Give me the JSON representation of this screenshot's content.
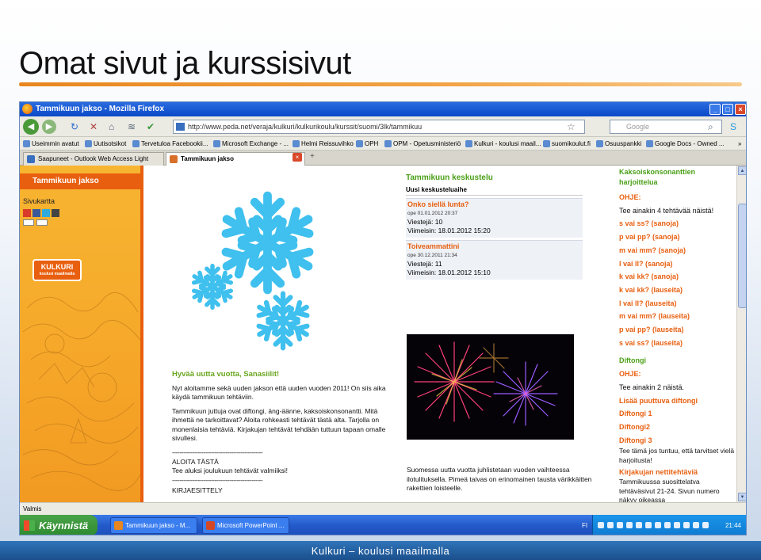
{
  "slide": {
    "title": "Omat sivut ja kurssisivut",
    "footer": "Kulkuri – koulusi maailmalla"
  },
  "browser": {
    "window_title": "Tammikuun jakso - Mozilla Firefox",
    "url": "http://www.peda.net/veraja/kulkuri/kulkurikoulu/kurssit/suomi/3lk/tammikuu",
    "search_placeholder": "Google",
    "bookmarks": [
      "Useimmin avatut",
      "Uutisotsikot",
      "Tervetuloa Facebookii...",
      "Microsoft Exchange - ...",
      "Helmi Reissuvihko",
      "OPH",
      "OPM - Opetusministeriö",
      "Kulkuri - koulusi maail...",
      "suomikoulut.fi",
      "Osuuspankki",
      "Google Docs - Owned ..."
    ],
    "tabs": [
      {
        "label": "Saapuneet - Outlook Web Access Light",
        "active": false
      },
      {
        "label": "Tammikuun jakso",
        "active": true
      }
    ],
    "status": "Valmis"
  },
  "page": {
    "nav_title": "Tammikuun jakso",
    "sitemap_label": "Sivukartta",
    "logo_text": "KULKURI",
    "logo_sub": "koulusi maailmalla",
    "post": {
      "heading": "Hyvää uutta vuotta, Sanasiilit!",
      "p1": "Nyt aloitamme sekä uuden jakson että uuden vuoden 2011! On siis aika käydä tammikuun tehtäviin.",
      "p2": "Tammikuun juttuja ovat diftongi, äng-äänne, kaksoiskonsonantti. Mitä ihmettä ne tarkoittavat? Aloita rohkeasti tehtävät tästä alta. Tarjolla on monenlaisia tehtäviä. Kirjakujan tehtävät tehdään tuttuun tapaan omalle sivullesi.",
      "dash1": "-------------------------------------------------",
      "start": "ALOITA TÄSTÄ",
      "start_text": "Tee aluksi joulukuun tehtävät valmiiksi!",
      "dash2": "-------------------------------------------------",
      "intro": "KIRJAESITTELY"
    },
    "forum": {
      "heading": "Tammikuun keskustelu",
      "subheading": "Uusi keskusteluaihe",
      "threads": [
        {
          "title": "Onko siellä lunta?",
          "meta": "ope 01.01.2012 20:37",
          "count": "Viestejä: 10",
          "latest": "Viimeisin: 18.01.2012 15:20"
        },
        {
          "title": "Toiveammattini",
          "meta": "ope 30.12.2011 21:34",
          "count": "Viestejä: 11",
          "latest": "Viimeisin: 18.01.2012 15:10"
        }
      ]
    },
    "fireworks_caption": "Suomessa uutta vuotta juhlistetaan vuoden vaihteessa ilotulituksella. Pimeä taivas on erinomainen tausta värikkäitten rakettien loisteelle.",
    "right": {
      "heading": "Kaksoiskonsonanttien harjoittelua",
      "ohje_label": "OHJE:",
      "ohje_text": "Tee ainakin 4 tehtävää näistä!",
      "links": [
        "s vai ss? (sanoja)",
        "p vai pp? (sanoja)",
        "m vai mm? (sanoja)",
        "l vai ll? (sanoja)",
        "k vai kk? (sanoja)",
        "k vai kk? (lauseita)",
        "l vai ll? (lauseita)",
        "m vai mm? (lauseita)",
        "p vai pp? (lauseita)",
        "s vai ss? (lauseita)"
      ],
      "diftongi_heading": "Diftongi",
      "diftongi_ohje_label": "OHJE:",
      "diftongi_ohje_text": "Tee ainakin 2 näistä.",
      "diftongi_links": [
        "Lisää puuttuva diftongi",
        "Diftongi 1",
        "Diftongi2",
        "Diftongi 3"
      ],
      "note": "Tee tämä jos tuntuu, että tarvitset vielä harjoitusta!",
      "kirjakuja_heading": "Kirjakujan nettitehtäviä",
      "kirjakuja_text": "Tammikuussa suosittelatva tehtäväsivut 21-24. Sivun numero näkyy oikeassa"
    }
  },
  "taskbar": {
    "start_label": "Käynnistä",
    "items": [
      "Tammikuun jakso - M...",
      "Microsoft PowerPoint ..."
    ],
    "lang": "FI",
    "clock": "21:44"
  },
  "colors": {
    "orange": "#e85f0f",
    "green": "#4ba018",
    "sidebar": "#f6a92a",
    "snow": "#3fc0ee"
  }
}
